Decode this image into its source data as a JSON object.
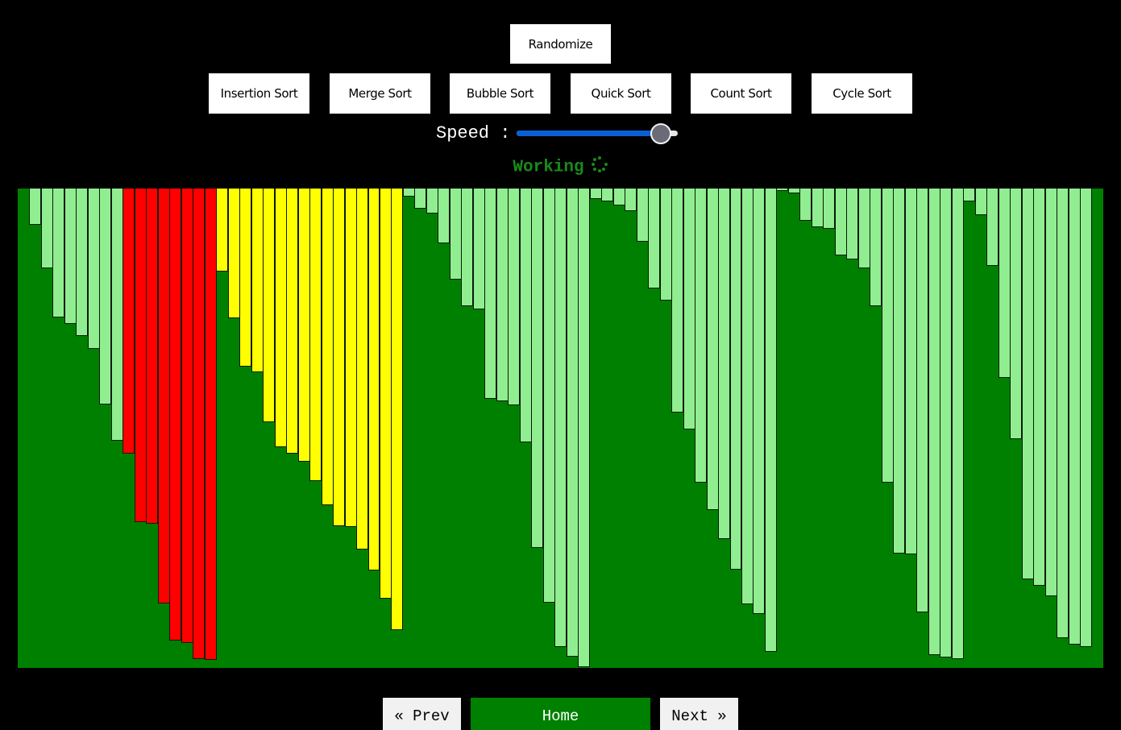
{
  "toolbar": {
    "randomize_label": "Randomize",
    "algorithms": [
      {
        "label": "Insertion Sort"
      },
      {
        "label": "Merge Sort"
      },
      {
        "label": "Bubble Sort"
      },
      {
        "label": "Quick Sort"
      },
      {
        "label": "Count Sort"
      },
      {
        "label": "Cycle Sort"
      }
    ]
  },
  "speed": {
    "label": "Speed :",
    "value": 89,
    "min": 0,
    "max": 100
  },
  "status": {
    "text": "Working",
    "icon": "spinner-icon"
  },
  "colors": {
    "background": "#008000",
    "default_bar": "#90EE90",
    "compare_bar": "#FF0000",
    "active_bar": "#FFFF00",
    "status_text": "#1a8a1a"
  },
  "chart_data": {
    "type": "bar",
    "title": "",
    "xlabel": "",
    "ylabel": "",
    "ylim": [
      0,
      100
    ],
    "grid": false,
    "orientation": "hanging-from-top",
    "bar_count": 93,
    "values": [
      0,
      7.6,
      16.6,
      26.9,
      28.2,
      30.8,
      33.4,
      45.0,
      52.6,
      55.3,
      69.6,
      69.9,
      86.6,
      94.3,
      94.8,
      98.2,
      98.3,
      17.3,
      27.1,
      37.1,
      38.3,
      48.7,
      53.9,
      55.3,
      57.0,
      61.0,
      66.1,
      70.4,
      70.6,
      75.3,
      79.7,
      85.5,
      92.1,
      1.7,
      4.2,
      5.2,
      11.4,
      19.0,
      24.5,
      25.2,
      43.9,
      44.4,
      45.2,
      52.9,
      75.0,
      86.4,
      95.6,
      97.6,
      99.8,
      2.2,
      2.7,
      3.5,
      4.7,
      11.1,
      20.8,
      23.4,
      46.7,
      50.3,
      61.3,
      67.1,
      73.1,
      79.5,
      86.7,
      88.7,
      96.6,
      0.5,
      1.0,
      6.7,
      8.1,
      8.4,
      13.9,
      14.8,
      16.6,
      24.5,
      61.3,
      76.1,
      76.3,
      88.4,
      97.3,
      97.8,
      98.2,
      2.7,
      5.5,
      16.1,
      39.5,
      52.3,
      81.5,
      82.9,
      85.0,
      93.8,
      95.1,
      95.6,
      0
    ],
    "states": {
      "compare": [
        9,
        10,
        11,
        12,
        13,
        14,
        15,
        16
      ],
      "active": [
        17,
        18,
        19,
        20,
        21,
        22,
        23,
        24,
        25,
        26,
        27,
        28,
        29,
        30,
        31,
        32
      ]
    }
  },
  "footer": {
    "prev_label": "« Prev",
    "home_label": "Home",
    "next_label": "Next »"
  }
}
